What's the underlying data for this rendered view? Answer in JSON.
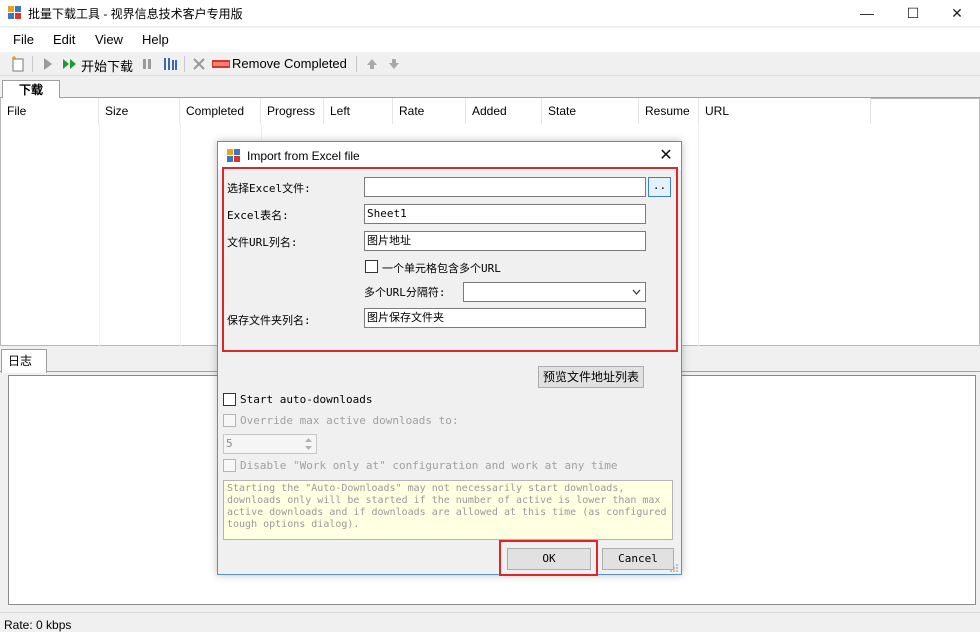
{
  "window": {
    "title": "批量下载工具 - 视界信息技术客户专用版",
    "minimize_glyph": "—",
    "maximize_glyph": "☐",
    "close_glyph": "✕"
  },
  "menu": {
    "items": [
      "File",
      "Edit",
      "View",
      "Help"
    ]
  },
  "toolbar": {
    "start_download_label": "开始下载",
    "remove_completed_label": "Remove Completed"
  },
  "tabs": {
    "download": "下载",
    "log": "日志"
  },
  "table": {
    "columns": [
      "File",
      "Size",
      "Completed",
      "Progress",
      "Left",
      "Rate",
      "Added",
      "State",
      "Resume",
      "URL"
    ]
  },
  "status": {
    "text": "Rate:  0 kbps"
  },
  "dialog": {
    "title": "Import from Excel file",
    "close_glyph": "✕",
    "excel_file_label": "选择Excel文件:",
    "excel_file_value": "",
    "browse_label": "..",
    "sheet_label": "Excel表名:",
    "sheet_value": "Sheet1",
    "url_column_label": "文件URL列名:",
    "url_column_value": "图片地址",
    "multi_url_label": "一个单元格包含多个URL",
    "multi_url_checked": false,
    "separator_label": "多个URL分隔符:",
    "separator_value": "",
    "save_folder_label": "保存文件夹列名:",
    "save_folder_value": "图片保存文件夹",
    "preview_button": "预览文件地址列表",
    "start_auto_label": "Start auto-downloads",
    "override_label": "Override max active downloads to:",
    "override_value": "5",
    "disable_label": "Disable \"Work only at\" configuration and work at any time",
    "note_text": "Starting the \"Auto-Downloads\" may not necessarily start downloads, downloads only will be started if the number of active is lower than max active downloads and if downloads are allowed at this time (as configured tough options dialog).",
    "ok_label": "OK",
    "cancel_label": "Cancel"
  },
  "colors": {
    "highlight": "#e0242e",
    "dialog_border": "#5a8fd0",
    "note_bg": "#ffffe1"
  }
}
